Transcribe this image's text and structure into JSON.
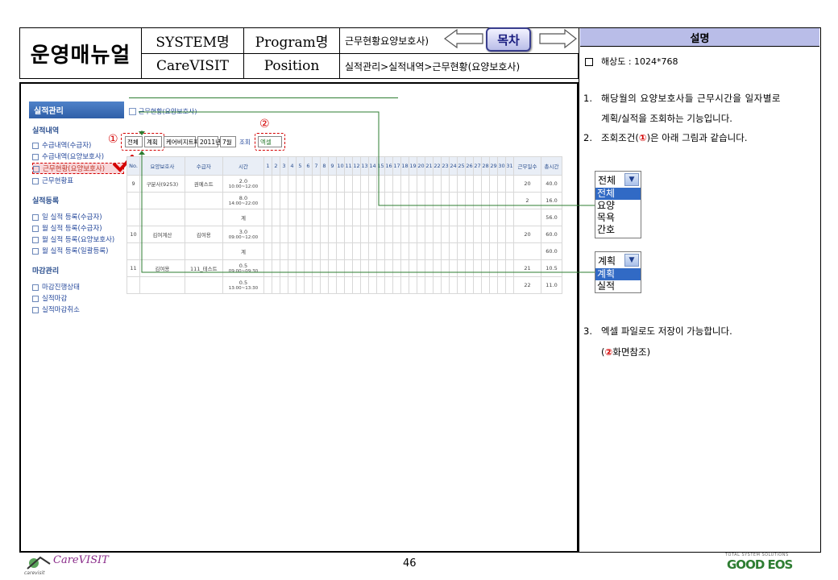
{
  "header": {
    "manual_title": "운영매뉴얼",
    "system_label": "SYSTEM명",
    "system_value": "CareVISIT",
    "program_label": "Program명",
    "position_label": "Position",
    "program_value": "근무현황요양보호사)",
    "position_value": "실적관리>실적내역>근무현황(요양보호사)",
    "toc_label": "목차"
  },
  "right_panel": {
    "title": "설명",
    "resolution": "해상도 : 1024*768",
    "item1_num": "1.",
    "item1_line1": "해당월의 요양보호사들 근무시간을 일자별로",
    "item1_line2": "계획/실적을 조회하는 기능입니다.",
    "item2_num": "2.",
    "item2_pre": "조회조건(",
    "item2_mark": "①",
    "item2_post": ")은 아래 그림과 같습니다.",
    "dropdown1": {
      "selected": "전체",
      "options": [
        "전체",
        "요양",
        "목욕",
        "간호"
      ]
    },
    "dropdown2": {
      "selected": "계획",
      "options": [
        "계획",
        "실적"
      ]
    },
    "item3_num": "3.",
    "item3_line1": "엑셀 파일로도 저장이 가능합니다.",
    "item3_pre": "(",
    "item3_mark": "②",
    "item3_post": "화면참조)"
  },
  "screenshot": {
    "sidebar": {
      "title": "실적관리",
      "section1": "실적내역",
      "section1_items": [
        "수급내역(수급자)",
        "수급내역(요양보호사)",
        "근무현황(요양보호사)",
        "근무현황표"
      ],
      "section2": "실적등록",
      "section2_items": [
        "일 실적 등록(수급자)",
        "월 실적 등록(수급자)",
        "월 실적 등록(요양보호사)",
        "월 실적 등록(일괄등록)"
      ],
      "section3": "마감관리",
      "section3_items": [
        "마감진행상태",
        "실적마감",
        "실적마감취소"
      ]
    },
    "page_heading": "근무현황(요양보호사)",
    "marker1": "①",
    "marker2": "②",
    "filters": {
      "type": "전체",
      "plan": "계획",
      "worker": "케어비지트파사",
      "year": "2011년",
      "month": "7월",
      "search": "조회",
      "excel": "엑셀"
    },
    "columns": [
      "No.",
      "요양보호사",
      "수급자",
      "시간",
      "1",
      "2",
      "3",
      "4",
      "5",
      "6",
      "7",
      "8",
      "9",
      "10",
      "11",
      "12",
      "13",
      "14",
      "15",
      "16",
      "17",
      "18",
      "19",
      "20",
      "21",
      "22",
      "23",
      "24",
      "25",
      "26",
      "27",
      "28",
      "29",
      "30",
      "31",
      "근무일수",
      "총시간"
    ],
    "rows": [
      {
        "no": "9",
        "worker": "구분사(9253)",
        "client": "권예스트",
        "hours": "2.0",
        "time": "10:00~12:00",
        "days": "20",
        "total": "40.0"
      },
      {
        "no": "",
        "worker": "",
        "client": "",
        "hours": "8.0",
        "time": "14:00~22:00",
        "days": "2",
        "total": "16.0"
      },
      {
        "no": "",
        "worker": "",
        "client": "",
        "hours": "계",
        "time": "",
        "days": "",
        "total": "56.0"
      },
      {
        "no": "10",
        "worker": "김여계산",
        "client": "김여용",
        "hours": "3.0",
        "time": "09:00~12:00",
        "days": "20",
        "total": "60.0"
      },
      {
        "no": "",
        "worker": "",
        "client": "",
        "hours": "계",
        "time": "",
        "days": "",
        "total": "60.0"
      },
      {
        "no": "11",
        "worker": "김여용",
        "client": "111_테스트",
        "hours": "0.5",
        "time": "09:00~09:30",
        "days": "21",
        "total": "10.5"
      },
      {
        "no": "",
        "worker": "",
        "client": "",
        "hours": "0.5",
        "time": "13:00~13:30",
        "days": "22",
        "total": "11.0"
      }
    ]
  },
  "footer": {
    "logo_text": "CareVISIT",
    "logo_sub": "carevisit",
    "page_number": "46",
    "brand": "GOOD EOS",
    "brand_small": "TOTAL SYSTEM SOLUTIONS"
  },
  "colors": {
    "accent": "#b9bde8",
    "link_blue": "#274a9c",
    "marker_red": "#d40000",
    "line_green": "#2e7d32"
  }
}
